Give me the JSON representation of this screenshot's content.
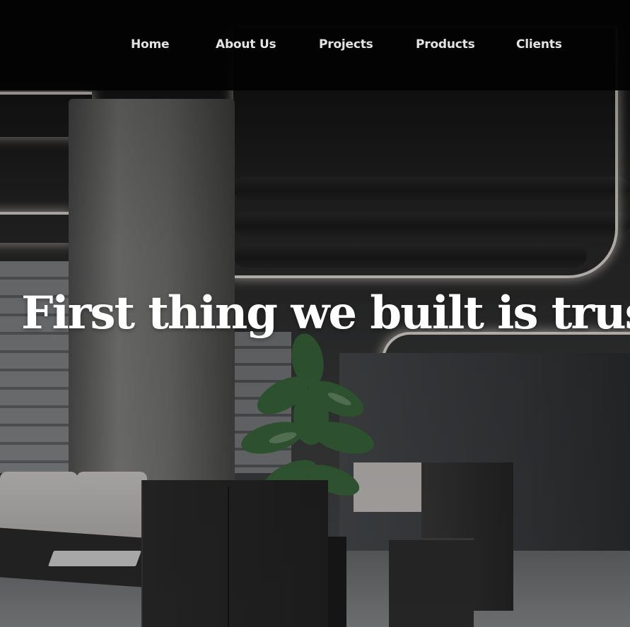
{
  "nav": {
    "items": [
      {
        "label": "Home"
      },
      {
        "label": "About Us"
      },
      {
        "label": "Projects"
      },
      {
        "label": "Products"
      },
      {
        "label": "Clients"
      }
    ]
  },
  "hero": {
    "headline": "First thing we built is trust",
    "background_image": "dark-office-interior"
  },
  "colors": {
    "header_bg": "#030303",
    "nav_text": "#e4e4e4",
    "headline_text": "#ffffff"
  }
}
